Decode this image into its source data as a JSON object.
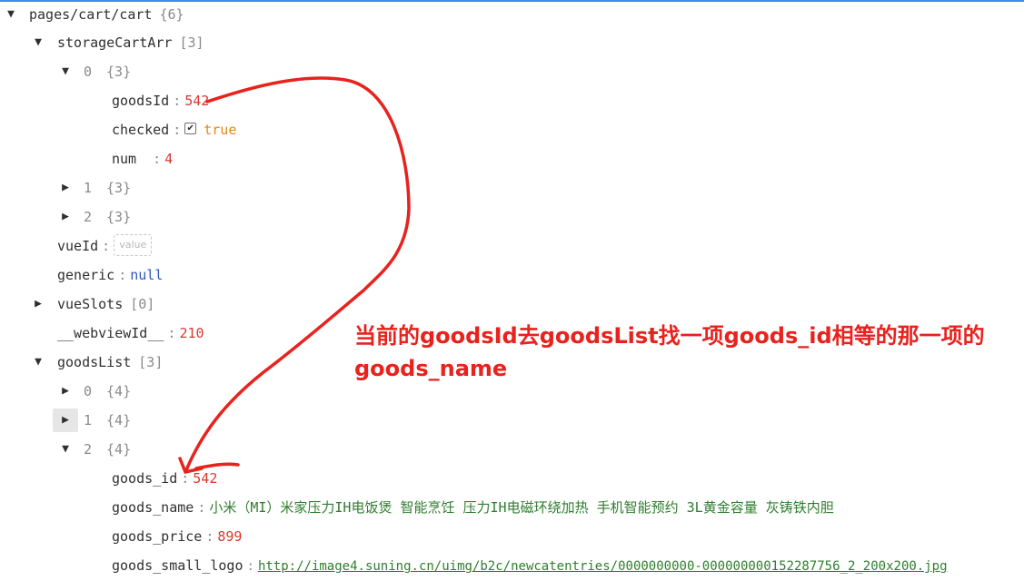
{
  "tree": {
    "root": {
      "key": "pages/cart/cart",
      "meta": "{6}"
    },
    "storageCartArr": {
      "key": "storageCartArr",
      "meta": "[3]"
    },
    "item0": {
      "index": "0",
      "meta": "{3}"
    },
    "goodsId": {
      "key": "goodsId",
      "value": "542"
    },
    "checked": {
      "key": "checked",
      "value": "true",
      "checked": true
    },
    "num": {
      "key": "num",
      "value": "4"
    },
    "item1": {
      "index": "1",
      "meta": "{3}"
    },
    "item2": {
      "index": "2",
      "meta": "{3}"
    },
    "vueId": {
      "key": "vueId",
      "placeholder": "value"
    },
    "generic": {
      "key": "generic",
      "value": "null"
    },
    "vueSlots": {
      "key": "vueSlots",
      "meta": "[0]"
    },
    "webviewId": {
      "key": "__webviewId__",
      "value": "210"
    },
    "goodsList": {
      "key": "goodsList",
      "meta": "[3]"
    },
    "gl0": {
      "index": "0",
      "meta": "{4}"
    },
    "gl1": {
      "index": "1",
      "meta": "{4}"
    },
    "gl2": {
      "index": "2",
      "meta": "{4}"
    },
    "goods_id": {
      "key": "goods_id",
      "value": "542"
    },
    "goods_name": {
      "key": "goods_name",
      "value": "小米（MI）米家压力IH电饭煲 智能烹饪 压力IH电磁环绕加热 手机智能预约 3L黄金容量 灰铸铁内胆"
    },
    "goods_price": {
      "key": "goods_price",
      "value": "899"
    },
    "goods_small_logo": {
      "key": "goods_small_logo",
      "value": "http://image4.suning.cn/uimg/b2c/newcatentries/0000000000-000000000152287756_2_200x200.jpg"
    }
  },
  "annotation": {
    "text": "当前的goodsId去goodsList找一项goods_id相等的那一项的goods_name",
    "color": "#e8221d"
  },
  "icons": {
    "expanded": "triangle-down",
    "collapsed": "triangle-right"
  }
}
